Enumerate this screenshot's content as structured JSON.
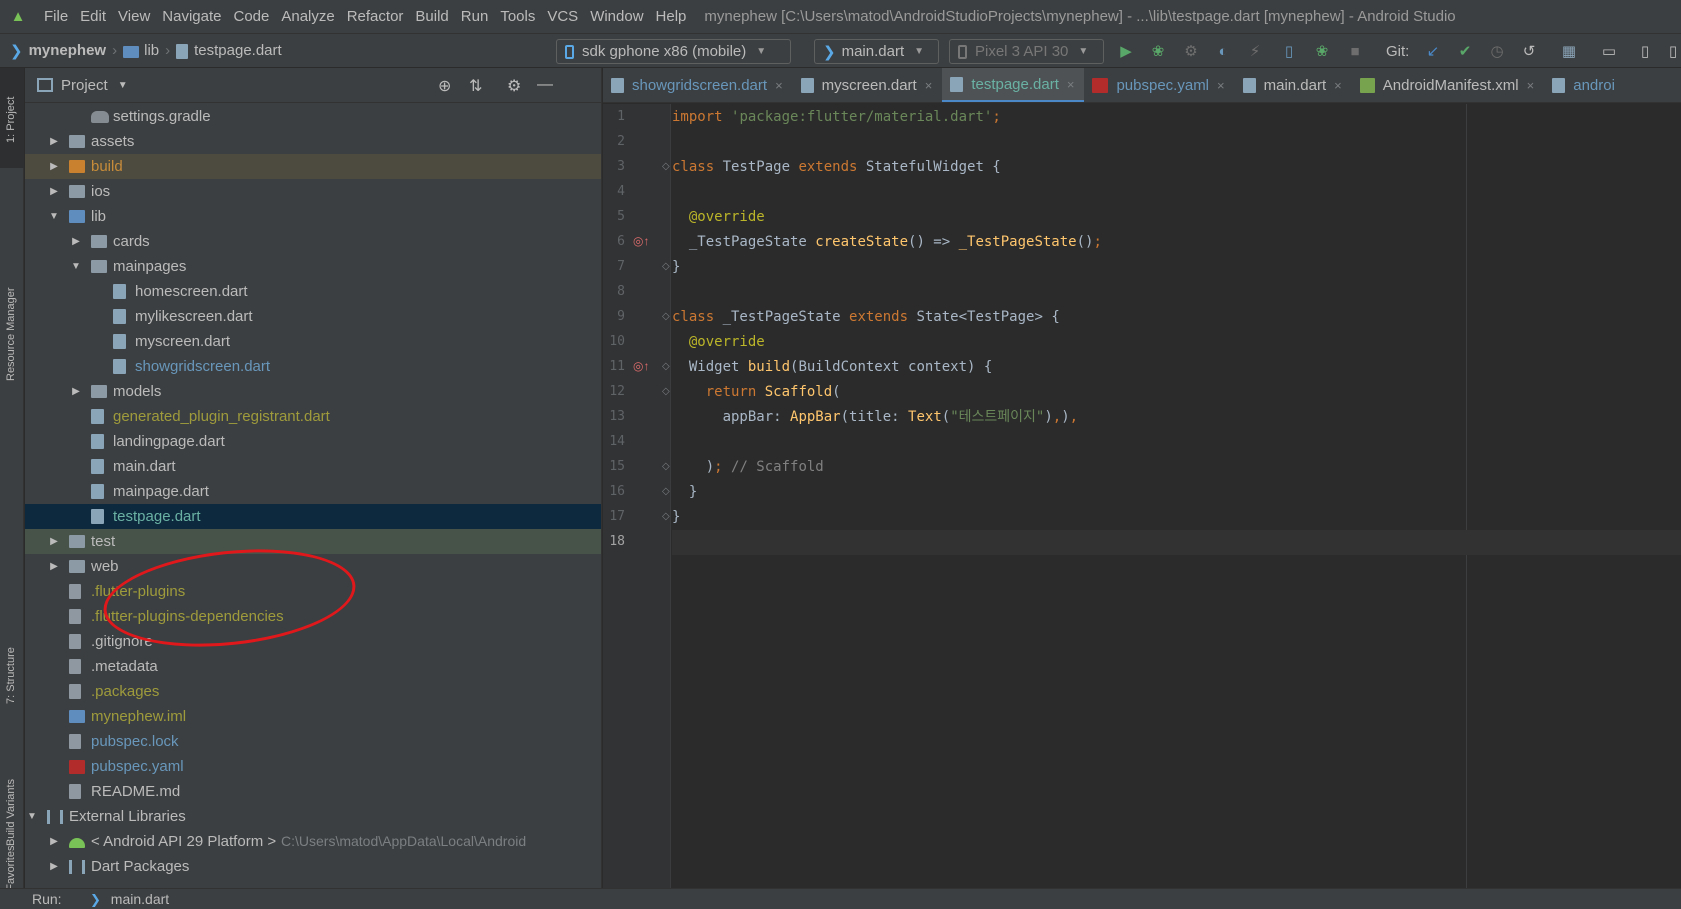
{
  "menubar": {
    "items": [
      "File",
      "Edit",
      "View",
      "Navigate",
      "Code",
      "Analyze",
      "Refactor",
      "Build",
      "Run",
      "Tools",
      "VCS",
      "Window",
      "Help"
    ],
    "window_title": "mynephew [C:\\Users\\matod\\AndroidStudioProjects\\mynephew] - ...\\lib\\testpage.dart [mynephew] - Android Studio"
  },
  "navbar": {
    "breadcrumb": [
      "mynephew",
      "lib",
      "testpage.dart"
    ],
    "device": "sdk gphone x86 (mobile)",
    "run_config": "main.dart",
    "emulator": "Pixel 3 API 30",
    "git_label": "Git:"
  },
  "left_stripe": {
    "tabs": [
      "1: Project",
      "Resource Manager",
      "7: Structure",
      "Build Variants",
      "2: Favorites"
    ]
  },
  "project_panel": {
    "title": "Project",
    "tree": [
      {
        "name": "settings.gradle",
        "icon": "gradle-icon",
        "color": "default"
      },
      {
        "name": "assets",
        "icon": "folder-icon",
        "color": "default",
        "arrow": "right"
      },
      {
        "name": "build",
        "icon": "folder-icon",
        "color": "orange",
        "arrow": "right",
        "highlight": "build"
      },
      {
        "name": "ios",
        "icon": "folder-icon",
        "color": "default",
        "arrow": "right"
      },
      {
        "name": "lib",
        "icon": "folder-icon",
        "color": "default",
        "arrow": "down"
      },
      {
        "name": "cards",
        "icon": "folder-icon",
        "color": "default",
        "arrow": "right"
      },
      {
        "name": "mainpages",
        "icon": "folder-icon",
        "color": "default",
        "arrow": "down"
      },
      {
        "name": "homescreen.dart",
        "icon": "dart-file-icon",
        "color": "default"
      },
      {
        "name": "mylikescreen.dart",
        "icon": "dart-file-icon",
        "color": "default"
      },
      {
        "name": "myscreen.dart",
        "icon": "dart-file-icon",
        "color": "default"
      },
      {
        "name": "showgridscreen.dart",
        "icon": "dart-file-icon",
        "color": "blue"
      },
      {
        "name": "models",
        "icon": "folder-icon",
        "color": "default",
        "arrow": "right"
      },
      {
        "name": "generated_plugin_registrant.dart",
        "icon": "dart-file-icon",
        "color": "olive"
      },
      {
        "name": "landingpage.dart",
        "icon": "dart-file-icon",
        "color": "default"
      },
      {
        "name": "main.dart",
        "icon": "dart-file-icon",
        "color": "default"
      },
      {
        "name": "mainpage.dart",
        "icon": "dart-file-icon",
        "color": "default"
      },
      {
        "name": "testpage.dart",
        "icon": "dart-file-icon",
        "color": "sel",
        "highlight": "selected"
      },
      {
        "name": "test",
        "icon": "folder-icon",
        "color": "default",
        "arrow": "right",
        "highlight": "test"
      },
      {
        "name": "web",
        "icon": "folder-icon",
        "color": "default",
        "arrow": "right"
      },
      {
        "name": ".flutter-plugins",
        "icon": "file-icon",
        "color": "olive"
      },
      {
        "name": ".flutter-plugins-dependencies",
        "icon": "file-icon",
        "color": "olive"
      },
      {
        "name": ".gitignore",
        "icon": "file-icon",
        "color": "default"
      },
      {
        "name": ".metadata",
        "icon": "file-icon",
        "color": "default"
      },
      {
        "name": ".packages",
        "icon": "file-icon",
        "color": "olive"
      },
      {
        "name": "mynephew.iml",
        "icon": "module-icon",
        "color": "olive"
      },
      {
        "name": "pubspec.lock",
        "icon": "file-icon",
        "color": "blue"
      },
      {
        "name": "pubspec.yaml",
        "icon": "yaml-icon",
        "color": "blue"
      },
      {
        "name": "README.md",
        "icon": "file-icon",
        "color": "default"
      },
      {
        "name": "External Libraries",
        "icon": "library-icon",
        "color": "default",
        "arrow": "down"
      },
      {
        "name": "< Android API 29 Platform >",
        "icon": "android-icon",
        "color": "default",
        "arrow": "right",
        "suffix": "C:\\Users\\matod\\AppData\\Local\\Android"
      },
      {
        "name": "Dart Packages",
        "icon": "library-icon",
        "color": "default",
        "arrow": "right"
      }
    ]
  },
  "editor": {
    "tabs": [
      {
        "label": "showgridscreen.dart",
        "icon": "dart-file-icon",
        "style": "blue"
      },
      {
        "label": "myscreen.dart",
        "icon": "dart-file-icon",
        "style": "default"
      },
      {
        "label": "testpage.dart",
        "icon": "dart-file-icon",
        "style": "active"
      },
      {
        "label": "pubspec.yaml",
        "icon": "yaml-icon",
        "style": "blue"
      },
      {
        "label": "main.dart",
        "icon": "dart-file-icon",
        "style": "default"
      },
      {
        "label": "AndroidManifest.xml",
        "icon": "xml-icon",
        "style": "default"
      },
      {
        "label": "androi",
        "icon": "gradle-icon",
        "style": "blue"
      }
    ],
    "lines": [
      [
        [
          "k",
          "import "
        ],
        [
          "s",
          "'package:flutter/material.dart'"
        ],
        [
          "k",
          ";"
        ]
      ],
      [],
      [
        [
          "k",
          "class "
        ],
        [
          "t",
          "TestPage "
        ],
        [
          "k",
          "extends "
        ],
        [
          "t",
          "StatefulWidget {"
        ]
      ],
      [],
      [
        [
          "t",
          "  "
        ],
        [
          "a",
          "@override"
        ]
      ],
      [
        [
          "t",
          "  _TestPageState "
        ],
        [
          "f",
          "createState"
        ],
        [
          "t",
          "() => "
        ],
        [
          "f",
          "_TestPageState"
        ],
        [
          "t",
          "()"
        ],
        [
          "k",
          ";"
        ]
      ],
      [
        [
          "t",
          "}"
        ]
      ],
      [],
      [
        [
          "k",
          "class "
        ],
        [
          "t",
          "_TestPageState "
        ],
        [
          "k",
          "extends "
        ],
        [
          "t",
          "State<TestPage> {"
        ]
      ],
      [
        [
          "t",
          "  "
        ],
        [
          "a",
          "@override"
        ]
      ],
      [
        [
          "t",
          "  Widget "
        ],
        [
          "f",
          "build"
        ],
        [
          "t",
          "(BuildContext context) {"
        ]
      ],
      [
        [
          "t",
          "    "
        ],
        [
          "k",
          "return "
        ],
        [
          "f",
          "Scaffold"
        ],
        [
          "t",
          "("
        ]
      ],
      [
        [
          "t",
          "      appBar: "
        ],
        [
          "f",
          "AppBar"
        ],
        [
          "t",
          "(title: "
        ],
        [
          "f",
          "Text"
        ],
        [
          "t",
          "("
        ],
        [
          "s",
          "\"테스트페이지\""
        ],
        [
          "t",
          ")"
        ],
        [
          "k",
          ","
        ],
        [
          "t",
          ")"
        ],
        [
          "k",
          ","
        ]
      ],
      [],
      [
        [
          "t",
          "    )"
        ],
        [
          "k",
          "; "
        ],
        [
          "cm",
          "// Scaffold"
        ]
      ],
      [
        [
          "t",
          "  }"
        ]
      ],
      [
        [
          "t",
          "}"
        ]
      ],
      []
    ],
    "line_numbers": [
      "1",
      "2",
      "3",
      "4",
      "5",
      "6",
      "7",
      "8",
      "9",
      "10",
      "11",
      "12",
      "13",
      "14",
      "15",
      "16",
      "17",
      "18"
    ],
    "current_line": 18
  },
  "bottom_bar": {
    "run_label": "Run:",
    "run_file": "main.dart"
  },
  "colors": {
    "accent": "#4a88c7",
    "annotation": "#e0181c",
    "keyword": "#cc7832",
    "string": "#6a8759",
    "annotation_code": "#bbb529",
    "function": "#ffc66d"
  }
}
